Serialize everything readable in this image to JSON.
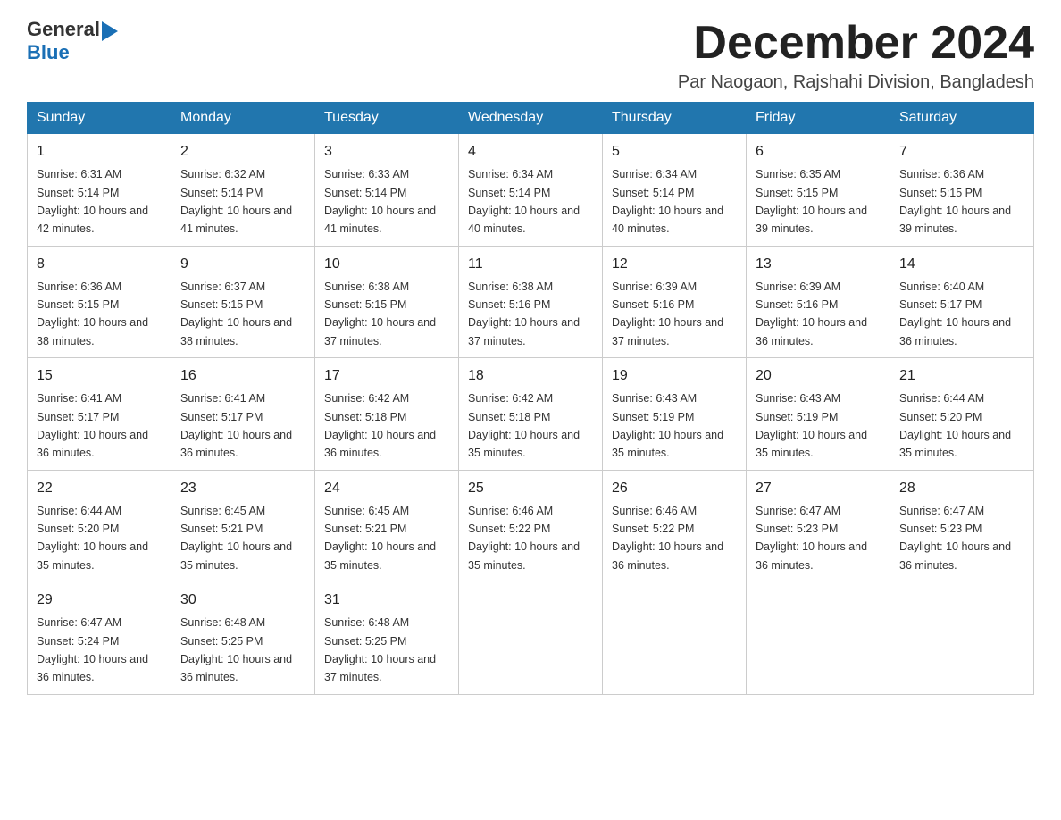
{
  "header": {
    "logo_general": "General",
    "logo_blue": "Blue",
    "month_title": "December 2024",
    "location": "Par Naogaon, Rajshahi Division, Bangladesh"
  },
  "days_of_week": [
    "Sunday",
    "Monday",
    "Tuesday",
    "Wednesday",
    "Thursday",
    "Friday",
    "Saturday"
  ],
  "weeks": [
    [
      {
        "day": "1",
        "sunrise": "6:31 AM",
        "sunset": "5:14 PM",
        "daylight": "10 hours and 42 minutes."
      },
      {
        "day": "2",
        "sunrise": "6:32 AM",
        "sunset": "5:14 PM",
        "daylight": "10 hours and 41 minutes."
      },
      {
        "day": "3",
        "sunrise": "6:33 AM",
        "sunset": "5:14 PM",
        "daylight": "10 hours and 41 minutes."
      },
      {
        "day": "4",
        "sunrise": "6:34 AM",
        "sunset": "5:14 PM",
        "daylight": "10 hours and 40 minutes."
      },
      {
        "day": "5",
        "sunrise": "6:34 AM",
        "sunset": "5:14 PM",
        "daylight": "10 hours and 40 minutes."
      },
      {
        "day": "6",
        "sunrise": "6:35 AM",
        "sunset": "5:15 PM",
        "daylight": "10 hours and 39 minutes."
      },
      {
        "day": "7",
        "sunrise": "6:36 AM",
        "sunset": "5:15 PM",
        "daylight": "10 hours and 39 minutes."
      }
    ],
    [
      {
        "day": "8",
        "sunrise": "6:36 AM",
        "sunset": "5:15 PM",
        "daylight": "10 hours and 38 minutes."
      },
      {
        "day": "9",
        "sunrise": "6:37 AM",
        "sunset": "5:15 PM",
        "daylight": "10 hours and 38 minutes."
      },
      {
        "day": "10",
        "sunrise": "6:38 AM",
        "sunset": "5:15 PM",
        "daylight": "10 hours and 37 minutes."
      },
      {
        "day": "11",
        "sunrise": "6:38 AM",
        "sunset": "5:16 PM",
        "daylight": "10 hours and 37 minutes."
      },
      {
        "day": "12",
        "sunrise": "6:39 AM",
        "sunset": "5:16 PM",
        "daylight": "10 hours and 37 minutes."
      },
      {
        "day": "13",
        "sunrise": "6:39 AM",
        "sunset": "5:16 PM",
        "daylight": "10 hours and 36 minutes."
      },
      {
        "day": "14",
        "sunrise": "6:40 AM",
        "sunset": "5:17 PM",
        "daylight": "10 hours and 36 minutes."
      }
    ],
    [
      {
        "day": "15",
        "sunrise": "6:41 AM",
        "sunset": "5:17 PM",
        "daylight": "10 hours and 36 minutes."
      },
      {
        "day": "16",
        "sunrise": "6:41 AM",
        "sunset": "5:17 PM",
        "daylight": "10 hours and 36 minutes."
      },
      {
        "day": "17",
        "sunrise": "6:42 AM",
        "sunset": "5:18 PM",
        "daylight": "10 hours and 36 minutes."
      },
      {
        "day": "18",
        "sunrise": "6:42 AM",
        "sunset": "5:18 PM",
        "daylight": "10 hours and 35 minutes."
      },
      {
        "day": "19",
        "sunrise": "6:43 AM",
        "sunset": "5:19 PM",
        "daylight": "10 hours and 35 minutes."
      },
      {
        "day": "20",
        "sunrise": "6:43 AM",
        "sunset": "5:19 PM",
        "daylight": "10 hours and 35 minutes."
      },
      {
        "day": "21",
        "sunrise": "6:44 AM",
        "sunset": "5:20 PM",
        "daylight": "10 hours and 35 minutes."
      }
    ],
    [
      {
        "day": "22",
        "sunrise": "6:44 AM",
        "sunset": "5:20 PM",
        "daylight": "10 hours and 35 minutes."
      },
      {
        "day": "23",
        "sunrise": "6:45 AM",
        "sunset": "5:21 PM",
        "daylight": "10 hours and 35 minutes."
      },
      {
        "day": "24",
        "sunrise": "6:45 AM",
        "sunset": "5:21 PM",
        "daylight": "10 hours and 35 minutes."
      },
      {
        "day": "25",
        "sunrise": "6:46 AM",
        "sunset": "5:22 PM",
        "daylight": "10 hours and 35 minutes."
      },
      {
        "day": "26",
        "sunrise": "6:46 AM",
        "sunset": "5:22 PM",
        "daylight": "10 hours and 36 minutes."
      },
      {
        "day": "27",
        "sunrise": "6:47 AM",
        "sunset": "5:23 PM",
        "daylight": "10 hours and 36 minutes."
      },
      {
        "day": "28",
        "sunrise": "6:47 AM",
        "sunset": "5:23 PM",
        "daylight": "10 hours and 36 minutes."
      }
    ],
    [
      {
        "day": "29",
        "sunrise": "6:47 AM",
        "sunset": "5:24 PM",
        "daylight": "10 hours and 36 minutes."
      },
      {
        "day": "30",
        "sunrise": "6:48 AM",
        "sunset": "5:25 PM",
        "daylight": "10 hours and 36 minutes."
      },
      {
        "day": "31",
        "sunrise": "6:48 AM",
        "sunset": "5:25 PM",
        "daylight": "10 hours and 37 minutes."
      },
      null,
      null,
      null,
      null
    ]
  ]
}
